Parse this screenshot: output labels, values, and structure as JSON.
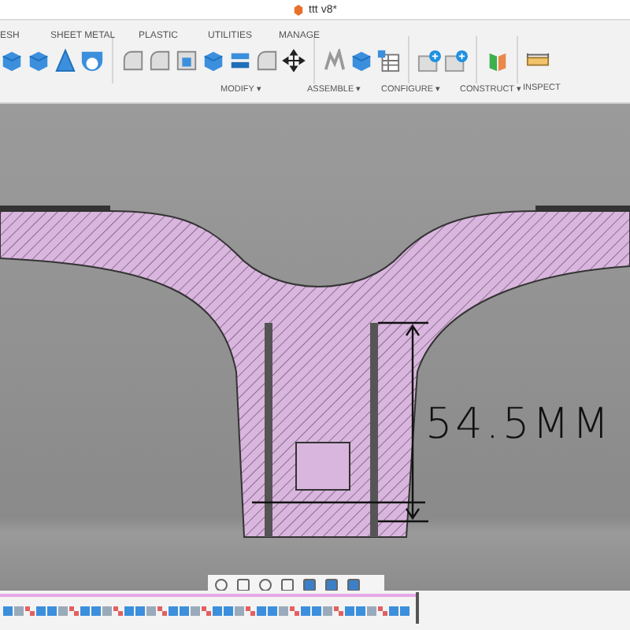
{
  "window": {
    "title": "ttt v8*"
  },
  "tabs": [
    "ESH",
    "SHEET METAL",
    "PLASTIC",
    "UTILITIES",
    "MANAGE"
  ],
  "groups": [
    "MODIFY ▾",
    "ASSEMBLE ▾",
    "CONFIGURE ▾",
    "CONSTRUCT ▾",
    "INSPECT"
  ],
  "annotation": {
    "text": "54.5MM"
  }
}
